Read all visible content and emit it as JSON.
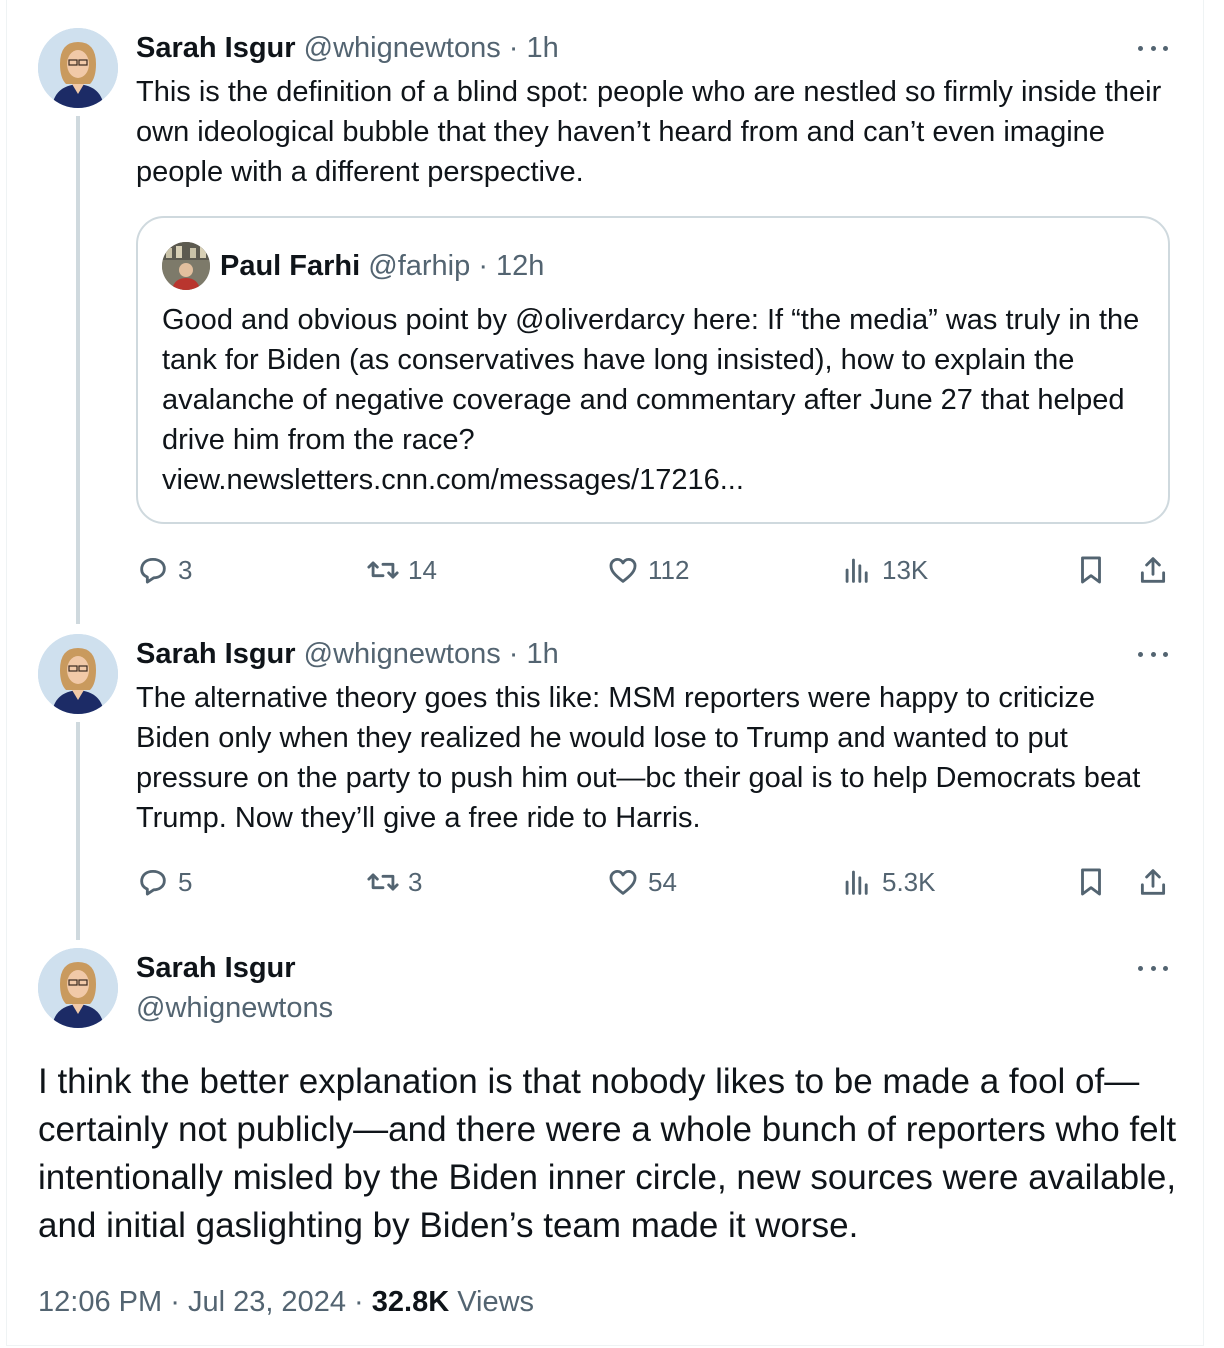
{
  "tweets": [
    {
      "author": "Sarah Isgur",
      "handle": "@whignewtons",
      "time": "1h",
      "text": "This is the definition of a blind spot: people who are nestled so firmly inside their own ideological bubble that they haven’t heard from and can’t even imagine people with a different perspective.",
      "quote": {
        "author": "Paul Farhi",
        "handle": "@farhip",
        "time": "12h",
        "text": "Good and obvious point by @oliverdarcy here: If “the media” was truly in the tank for Biden (as conservatives have long insisted), how to explain the avalanche of negative coverage and commentary after June 27 that helped drive him from the race?",
        "link": "view.newsletters.cnn.com/messages/17216..."
      },
      "stats": {
        "replies": "3",
        "reposts": "14",
        "likes": "112",
        "views": "13K"
      }
    },
    {
      "author": "Sarah Isgur",
      "handle": "@whignewtons",
      "time": "1h",
      "text": "The alternative theory goes this like: MSM reporters were happy to criticize Biden only when they realized he would lose to Trump and wanted to put pressure on the party to push him out—bc their goal is to help Democrats beat Trump. Now they’ll give a free ride to Harris.",
      "stats": {
        "replies": "5",
        "reposts": "3",
        "likes": "54",
        "views": "5.3K"
      }
    }
  ],
  "main": {
    "author": "Sarah Isgur",
    "handle": "@whignewtons",
    "text": "I think the better explanation is that nobody likes to be made a fool of—certainly not publicly—and there were a whole bunch of reporters who felt intentionally misled by the Biden inner circle, new sources were available, and initial gaslighting by Biden’s team made it worse.",
    "time": "12:06 PM",
    "date": "Jul 23, 2024",
    "views_count": "32.8K",
    "views_label": "Views"
  },
  "separator": "·",
  "icons": [
    "more-icon",
    "reply-icon",
    "repost-icon",
    "like-icon",
    "views-icon",
    "bookmark-icon",
    "share-icon"
  ],
  "colors": {
    "text": "#0f1419",
    "secondary": "#536471",
    "border": "#cfd9de"
  }
}
